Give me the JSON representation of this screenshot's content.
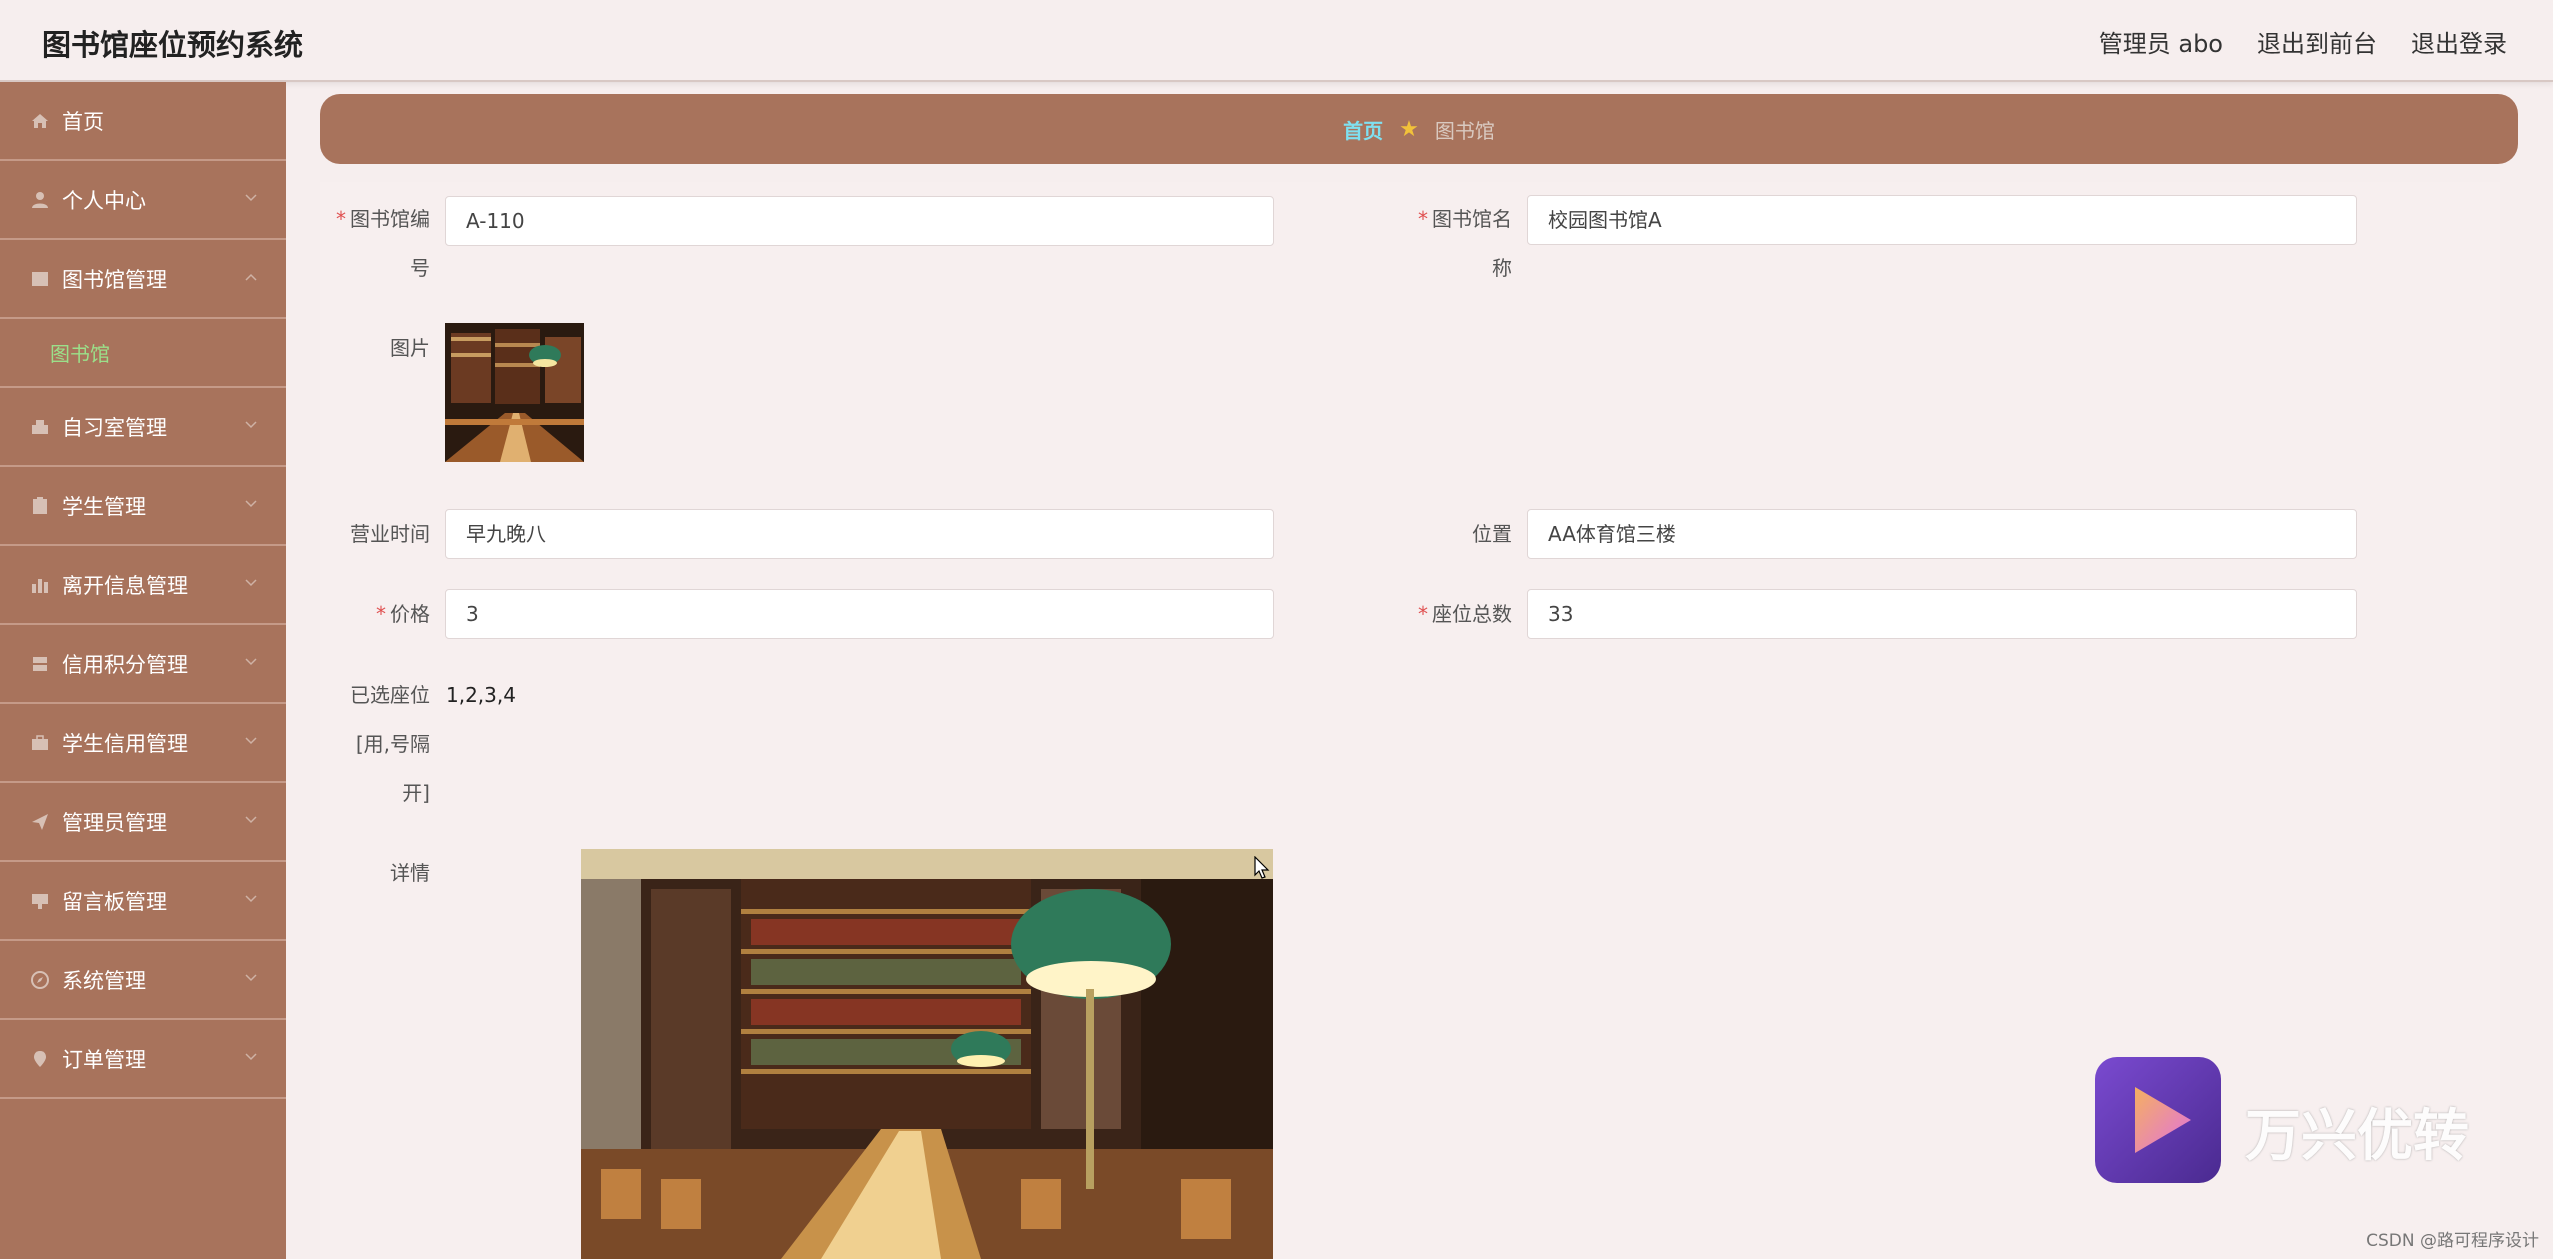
{
  "app": {
    "title": "图书馆座位预约系统"
  },
  "header": {
    "user": "管理员 abo",
    "to_front": "退出到前台",
    "logout": "退出登录"
  },
  "sidebar": {
    "items": [
      {
        "label": "首页",
        "icon": "home-icon"
      },
      {
        "label": "个人中心",
        "icon": "user-icon"
      },
      {
        "label": "图书馆管理",
        "icon": "library-icon",
        "expanded": true,
        "sub": [
          "图书馆"
        ]
      },
      {
        "label": "自习室管理",
        "icon": "study-room-icon"
      },
      {
        "label": "学生管理",
        "icon": "clipboard-icon"
      },
      {
        "label": "离开信息管理",
        "icon": "chart-icon"
      },
      {
        "label": "信用积分管理",
        "icon": "credit-icon"
      },
      {
        "label": "学生信用管理",
        "icon": "briefcase-icon"
      },
      {
        "label": "管理员管理",
        "icon": "send-icon"
      },
      {
        "label": "留言板管理",
        "icon": "message-icon"
      },
      {
        "label": "系统管理",
        "icon": "compass-icon"
      },
      {
        "label": "订单管理",
        "icon": "location-icon"
      }
    ]
  },
  "breadcrumb": {
    "home": "首页",
    "current": "图书馆"
  },
  "form": {
    "code_label_1": "图书馆编",
    "code_label_2": "号",
    "code_value": "A-110",
    "name_label_1": "图书馆名",
    "name_label_2": "称",
    "name_value": "校园图书馆A",
    "image_label": "图片",
    "hours_label": "营业时间",
    "hours_value": "早九晚八",
    "location_label": "位置",
    "location_value": "AA体育馆三楼",
    "price_label": "价格",
    "price_value": "3",
    "seats_label": "座位总数",
    "seats_value": "33",
    "selected_label_1": "已选座位",
    "selected_label_2": "[用,号隔",
    "selected_label_3": "开]",
    "selected_value": "1,2,3,4",
    "detail_label": "详情"
  },
  "watermark": {
    "text": "万兴优转"
  },
  "footer": {
    "credit": "CSDN @路可程序设计"
  },
  "colors": {
    "sidebar": "#a8735c",
    "background": "#f6eeee",
    "active_sub": "#9be08a",
    "breadcrumb_home": "#7fe0f0",
    "required": "#e05050"
  }
}
